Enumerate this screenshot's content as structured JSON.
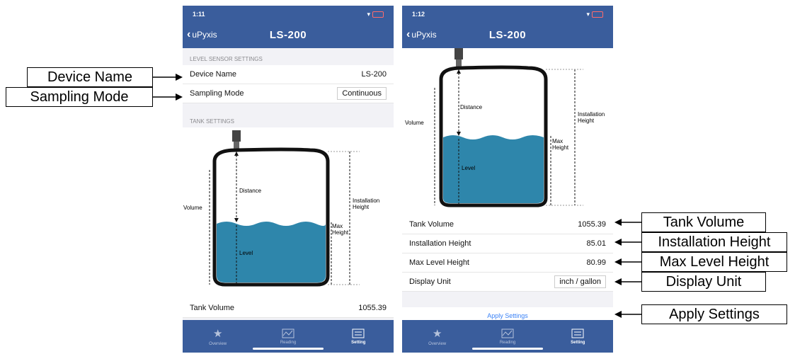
{
  "callouts": {
    "device_name": "Device Name",
    "sampling_mode": "Sampling Mode",
    "tank_volume": "Tank Volume",
    "installation_height": "Installation Height",
    "max_level_height": "Max Level  Height",
    "display_unit": "Display Unit",
    "apply_settings": "Apply Settings"
  },
  "phone1": {
    "time": "1:11",
    "back_label": "uPyxis",
    "title": "LS-200",
    "section_level": "LEVEL SENSOR SETTINGS",
    "device_name_label": "Device Name",
    "device_name_value": "LS-200",
    "sampling_mode_label": "Sampling Mode",
    "sampling_mode_value": "Continuous",
    "section_tank": "TANK SETTINGS",
    "tank_volume_label": "Tank Volume",
    "tank_volume_value": "1055.39"
  },
  "phone2": {
    "time": "1:12",
    "back_label": "uPyxis",
    "title": "LS-200",
    "tank_volume_label": "Tank Volume",
    "tank_volume_value": "1055.39",
    "installation_height_label": "Installation Height",
    "installation_height_value": "85.01",
    "max_level_height_label": "Max Level Height",
    "max_level_height_value": "80.99",
    "display_unit_label": "Display Unit",
    "display_unit_value": "inch / gallon",
    "apply_label": "Apply Settings"
  },
  "diagram": {
    "distance": "Distance",
    "level": "Level",
    "volume": "Volume",
    "installation_height": "Installation\nHeight",
    "max_height": "Max\nHeight"
  },
  "tabs": [
    {
      "label": "Overview",
      "icon": "star-icon"
    },
    {
      "label": "Reading",
      "icon": "chart-icon"
    },
    {
      "label": "Setting",
      "icon": "settings-icon"
    }
  ],
  "colors": {
    "nav": "#3a5d9c",
    "water": "#2e86ab",
    "link": "#3b82f6"
  }
}
